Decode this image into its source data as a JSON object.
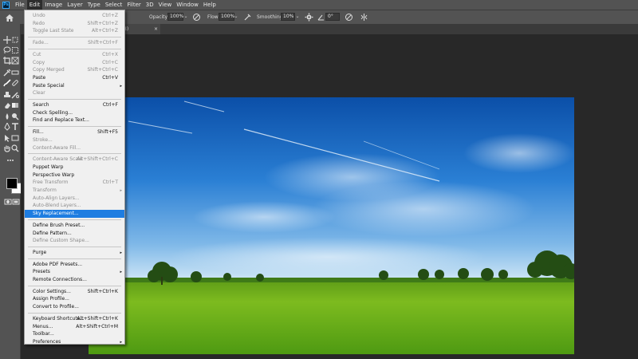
{
  "app": {
    "logo_text": "Ps"
  },
  "menubar": {
    "items": [
      "File",
      "Edit",
      "Image",
      "Layer",
      "Type",
      "Select",
      "Filter",
      "3D",
      "View",
      "Window",
      "Help"
    ],
    "active": "Edit"
  },
  "options": {
    "opacity_label": "Opacity:",
    "opacity_value": "100%",
    "flow_label": "Flow:",
    "flow_value": "100%",
    "smoothing_label": "Smoothing:",
    "smoothing_value": "10%",
    "angle_value": "0°",
    "dropdown_arrow": "⌄"
  },
  "document_tab": {
    "label": "8)",
    "close": "×"
  },
  "edit_menu": {
    "items": [
      {
        "label": "Undo",
        "shortcut": "Ctrl+Z",
        "disabled": true
      },
      {
        "label": "Redo",
        "shortcut": "Shift+Ctrl+Z",
        "disabled": true
      },
      {
        "label": "Toggle Last State",
        "shortcut": "Alt+Ctrl+Z",
        "disabled": true
      },
      {
        "sep": true
      },
      {
        "label": "Fade...",
        "shortcut": "Shift+Ctrl+F",
        "disabled": true
      },
      {
        "sep": true
      },
      {
        "label": "Cut",
        "shortcut": "Ctrl+X",
        "disabled": true
      },
      {
        "label": "Copy",
        "shortcut": "Ctrl+C",
        "disabled": true
      },
      {
        "label": "Copy Merged",
        "shortcut": "Shift+Ctrl+C",
        "disabled": true
      },
      {
        "label": "Paste",
        "shortcut": "Ctrl+V",
        "disabled": false
      },
      {
        "label": "Paste Special",
        "submenu": true,
        "disabled": false
      },
      {
        "label": "Clear",
        "disabled": true
      },
      {
        "sep": true
      },
      {
        "label": "Search",
        "shortcut": "Ctrl+F",
        "disabled": false
      },
      {
        "label": "Check Spelling...",
        "disabled": false
      },
      {
        "label": "Find and Replace Text...",
        "disabled": false
      },
      {
        "sep": true
      },
      {
        "label": "Fill...",
        "shortcut": "Shift+F5",
        "disabled": false
      },
      {
        "label": "Stroke...",
        "disabled": true
      },
      {
        "label": "Content-Aware Fill...",
        "disabled": true
      },
      {
        "sep": true
      },
      {
        "label": "Content-Aware Scale",
        "shortcut": "Alt+Shift+Ctrl+C",
        "disabled": true
      },
      {
        "label": "Puppet Warp",
        "disabled": false
      },
      {
        "label": "Perspective Warp",
        "disabled": false
      },
      {
        "label": "Free Transform",
        "shortcut": "Ctrl+T",
        "disabled": true
      },
      {
        "label": "Transform",
        "submenu": true,
        "disabled": true
      },
      {
        "label": "Auto-Align Layers...",
        "disabled": true
      },
      {
        "label": "Auto-Blend Layers...",
        "disabled": true
      },
      {
        "label": "Sky Replacement...",
        "disabled": false,
        "highlight": true
      },
      {
        "sep": true
      },
      {
        "label": "Define Brush Preset...",
        "disabled": false
      },
      {
        "label": "Define Pattern...",
        "disabled": false
      },
      {
        "label": "Define Custom Shape...",
        "disabled": true
      },
      {
        "sep": true
      },
      {
        "label": "Purge",
        "submenu": true,
        "disabled": false
      },
      {
        "sep": true
      },
      {
        "label": "Adobe PDF Presets...",
        "disabled": false
      },
      {
        "label": "Presets",
        "submenu": true,
        "disabled": false
      },
      {
        "label": "Remote Connections...",
        "disabled": false
      },
      {
        "sep": true
      },
      {
        "label": "Color Settings...",
        "shortcut": "Shift+Ctrl+K",
        "disabled": false
      },
      {
        "label": "Assign Profile...",
        "disabled": false
      },
      {
        "label": "Convert to Profile...",
        "disabled": false
      },
      {
        "sep": true
      },
      {
        "label": "Keyboard Shortcuts...",
        "shortcut": "Alt+Shift+Ctrl+K",
        "disabled": false
      },
      {
        "label": "Menus...",
        "shortcut": "Alt+Shift+Ctrl+M",
        "disabled": false
      },
      {
        "label": "Toolbar...",
        "disabled": false
      },
      {
        "label": "Preferences",
        "submenu": true,
        "disabled": false
      }
    ]
  },
  "submenu_arrow": "▸",
  "tools": [
    "move-tool-icon",
    "artboard-tool-icon",
    "lasso-tool-icon",
    "marquee-tool-icon",
    "crop-tool-icon",
    "frame-tool-icon",
    "eyedropper-tool-icon",
    "brush-tool-icon",
    "healing-tool-icon",
    "clone-stamp-tool-icon",
    "history-brush-tool-icon",
    "eraser-tool-icon",
    "gradient-tool-icon",
    "blur-tool-icon",
    "dodge-tool-icon",
    "pen-tool-icon",
    "type-tool-icon",
    "path-select-tool-icon",
    "rectangle-tool-icon",
    "hand-tool-icon",
    "zoom-tool-icon",
    "edit-toolbar-icon"
  ],
  "colors": {
    "menu_highlight": "#1e7de1",
    "ui_dark": "#282828",
    "ui_panel": "#535353",
    "foreground": "#000000",
    "background": "#ffffff"
  }
}
